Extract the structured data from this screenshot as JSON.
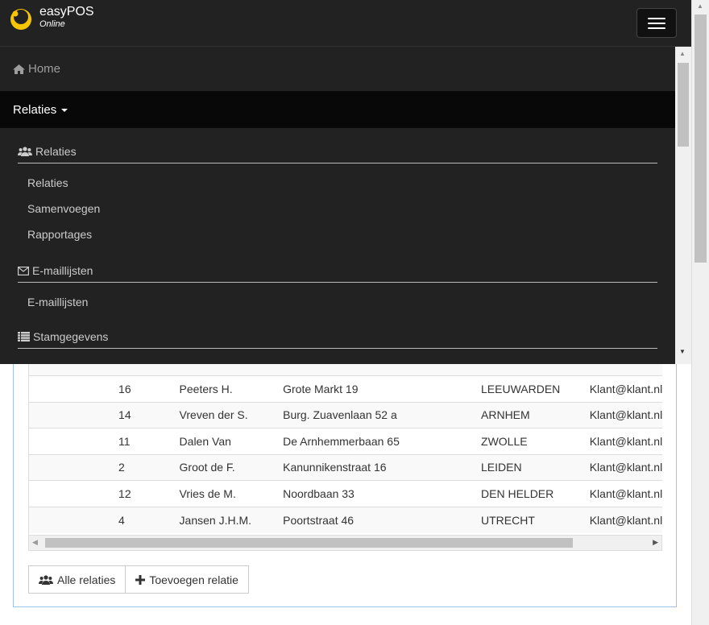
{
  "brand": {
    "name": "easyPOS",
    "sub": "Online"
  },
  "nav": {
    "home": "Home",
    "relaties": "Relaties"
  },
  "menu": {
    "sections": [
      {
        "title": "Relaties",
        "icon": "users-icon",
        "items": [
          "Relaties",
          "Samenvoegen",
          "Rapportages"
        ]
      },
      {
        "title": "E-maillijsten",
        "icon": "envelope-icon",
        "items": [
          "E-maillijsten"
        ]
      },
      {
        "title": "Stamgegevens",
        "icon": "list-icon",
        "items": []
      }
    ]
  },
  "table": {
    "rows": [
      [
        "",
        "16",
        "Peeters H.",
        "Grote Markt 19",
        "LEEUWARDEN",
        "Klant@klant.nl"
      ],
      [
        "",
        "14",
        "Vreven der S.",
        "Burg. Zuavenlaan 52 a",
        "ARNHEM",
        "Klant@klant.nl"
      ],
      [
        "",
        "11",
        "Dalen Van",
        "De Arnhemmerbaan 65",
        "ZWOLLE",
        "Klant@klant.nl"
      ],
      [
        "",
        "2",
        "Groot de F.",
        "Kanunnikenstraat 16",
        "LEIDEN",
        "Klant@klant.nl"
      ],
      [
        "",
        "12",
        "Vries de M.",
        "Noordbaan 33",
        "DEN HELDER",
        "Klant@klant.nl"
      ],
      [
        "",
        "4",
        "Jansen J.H.M.",
        "Poortstraat 46",
        "UTRECHT",
        "Klant@klant.nl"
      ]
    ]
  },
  "buttons": {
    "all": "Alle relaties",
    "add": "Toevoegen relatie"
  }
}
